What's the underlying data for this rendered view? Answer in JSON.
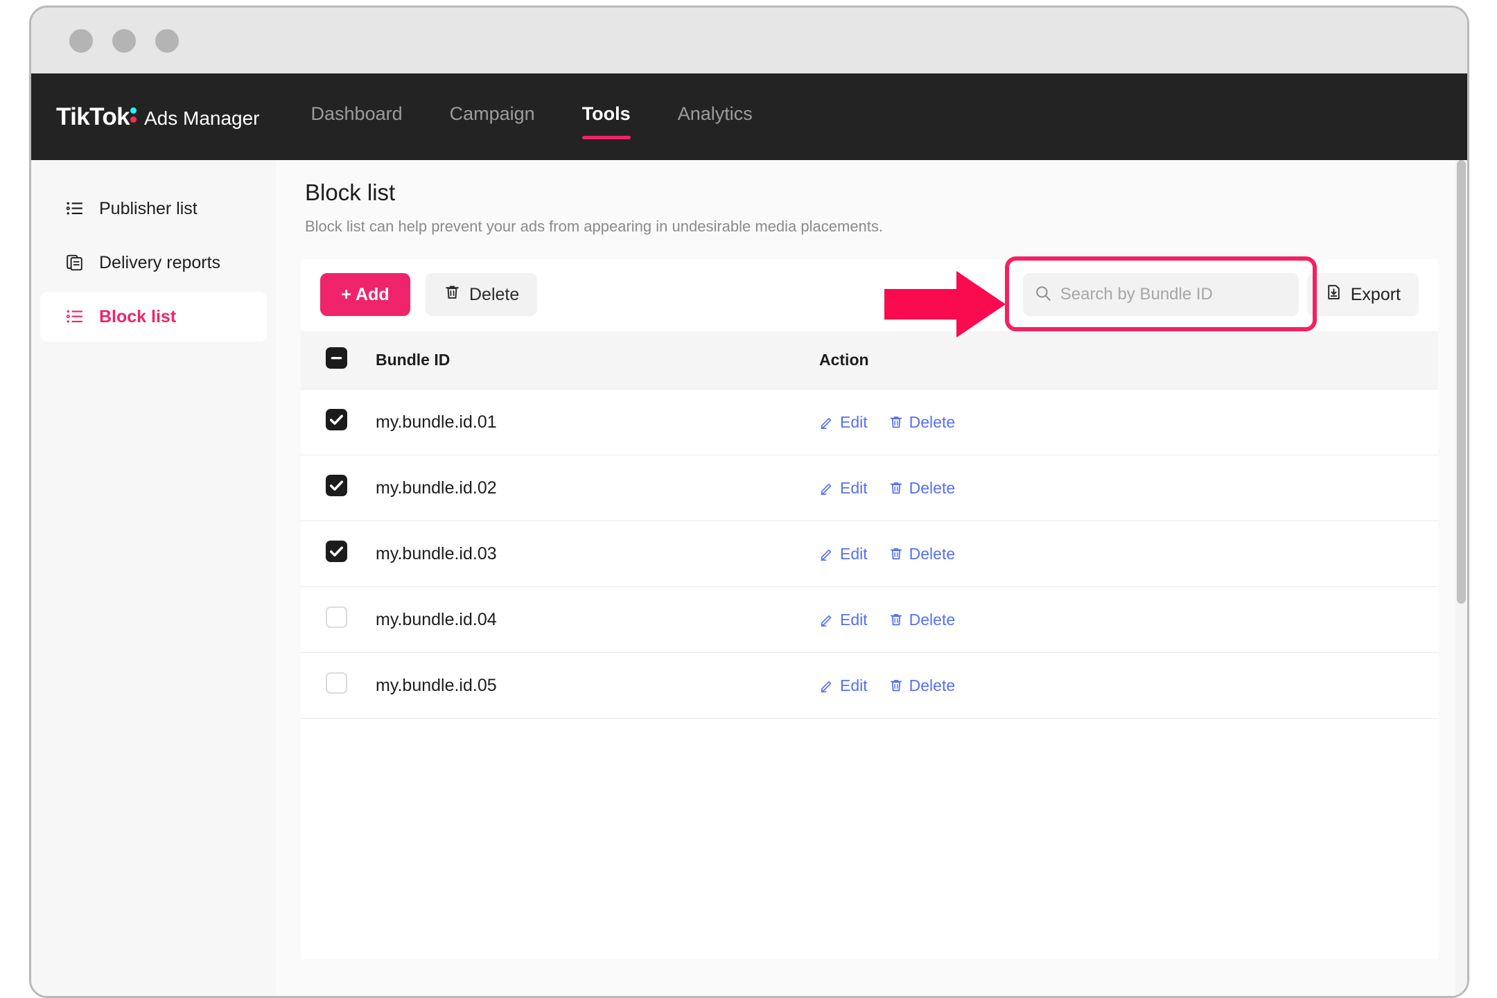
{
  "window": {
    "traffic_lights": [
      "close",
      "minimize",
      "maximize"
    ]
  },
  "topnav": {
    "brand_logo": "TikTok",
    "brand_sub": "Ads Manager",
    "items": [
      {
        "label": "Dashboard",
        "active": false
      },
      {
        "label": "Campaign",
        "active": false
      },
      {
        "label": "Tools",
        "active": true
      },
      {
        "label": "Analytics",
        "active": false
      }
    ],
    "background": "#232323",
    "active_underline_color": "#f0246a"
  },
  "sidebar": {
    "items": [
      {
        "label": "Publisher list",
        "icon": "ordered-list-icon",
        "active": false
      },
      {
        "label": "Delivery reports",
        "icon": "document-copy-icon",
        "active": false
      },
      {
        "label": "Block list",
        "icon": "ordered-list-icon",
        "active": true
      }
    ],
    "active_color": "#f0246a"
  },
  "page": {
    "title": "Block list",
    "description": "Block list can help prevent your ads from appearing in undesirable media placements."
  },
  "toolbar": {
    "add_label": "+ Add",
    "delete_label": "Delete",
    "export_label": "Export",
    "add_color": "#f0246a"
  },
  "search": {
    "value": "",
    "placeholder": "Search by Bundle ID",
    "highlight_color": "#f5205f",
    "arrow_color": "#fa0a4e"
  },
  "table": {
    "columns": [
      "Bundle ID",
      "Action"
    ],
    "header_checkbox_state": "indeterminate",
    "rows": [
      {
        "bundle_id": "my.bundle.id.01",
        "checked": true,
        "edit_label": "Edit",
        "delete_label": "Delete"
      },
      {
        "bundle_id": "my.bundle.id.02",
        "checked": true,
        "edit_label": "Edit",
        "delete_label": "Delete"
      },
      {
        "bundle_id": "my.bundle.id.03",
        "checked": true,
        "edit_label": "Edit",
        "delete_label": "Delete"
      },
      {
        "bundle_id": "my.bundle.id.04",
        "checked": false,
        "edit_label": "Edit",
        "delete_label": "Delete"
      },
      {
        "bundle_id": "my.bundle.id.05",
        "checked": false,
        "edit_label": "Edit",
        "delete_label": "Delete"
      }
    ],
    "action_link_color": "#5570f5"
  }
}
